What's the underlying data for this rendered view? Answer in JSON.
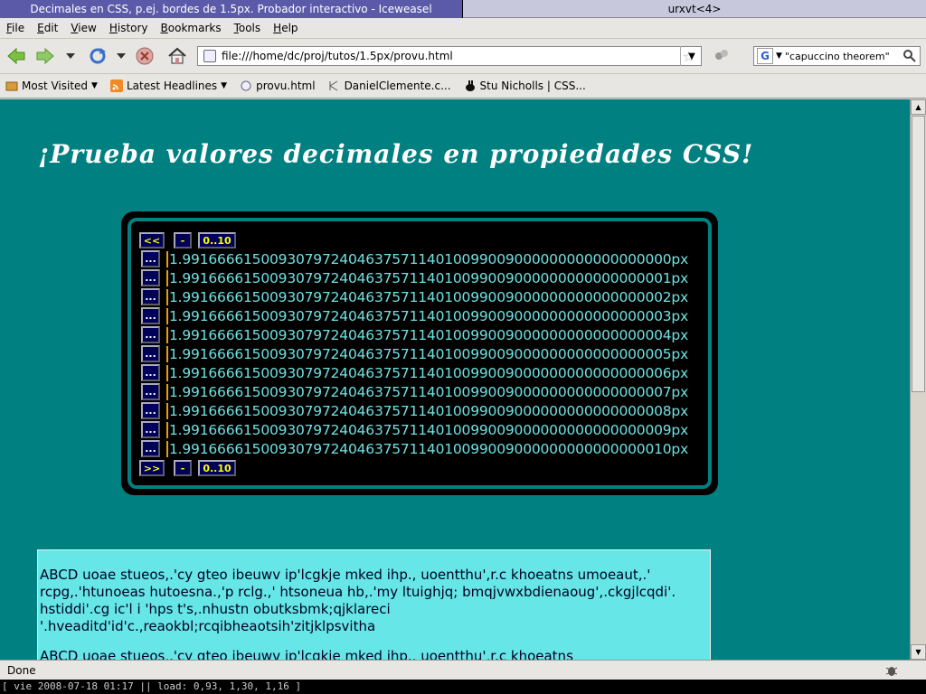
{
  "titlebar": {
    "active_title": "Decimales en CSS, p.ej. bordes de 1.5px. Probador interactivo - Iceweasel",
    "inactive_title": "urxvt<4>"
  },
  "menu": {
    "items": [
      {
        "first": "F",
        "rest": "ile"
      },
      {
        "first": "E",
        "rest": "dit"
      },
      {
        "first": "V",
        "rest": "iew"
      },
      {
        "first": "H",
        "rest": "istory"
      },
      {
        "first": "B",
        "rest": "ookmarks"
      },
      {
        "first": "T",
        "rest": "ools"
      },
      {
        "first": "H",
        "rest": "elp"
      }
    ]
  },
  "nav": {
    "url": "file:///home/dc/proj/tutos/1.5px/provu.html",
    "search_value": "\"capuccino theorem\""
  },
  "bookmarks": [
    {
      "label": "Most Visited",
      "dropdown": "▼"
    },
    {
      "label": "Latest Headlines",
      "dropdown": "▼"
    },
    {
      "label": "provu.html"
    },
    {
      "label": "DanielClemente.c..."
    },
    {
      "label": "Stu Nicholls | CSS..."
    }
  ],
  "page": {
    "heading": "¡Prueba valores decimales en propiedades CSS!",
    "top_controls": {
      "prev": "<<",
      "minus": "-",
      "range": "0..10"
    },
    "bottom_controls": {
      "next": ">>",
      "minus": "-",
      "range": "0..10"
    },
    "row_button": "...",
    "rows": [
      "1.99166661500930797240463757114010099009000000000000000000px",
      "1.99166661500930797240463757114010099009000000000000000001px",
      "1.99166661500930797240463757114010099009000000000000000002px",
      "1.99166661500930797240463757114010099009000000000000000003px",
      "1.99166661500930797240463757114010099009000000000000000004px",
      "1.99166661500930797240463757114010099009000000000000000005px",
      "1.99166661500930797240463757114010099009000000000000000006px",
      "1.99166661500930797240463757114010099009000000000000000007px",
      "1.99166661500930797240463757114010099009000000000000000008px",
      "1.99166661500930797240463757114010099009000000000000000009px",
      "1.99166661500930797240463757114010099009000000000000000010px"
    ],
    "paragraphs": [
      "ABCD uoae stueos,.'cy gteo ibeuwv ip'lcgkje mked ihp., uoentthu',r.c khoeatns umoeaut,.' rcpg,.'htunoeas hutoesna.,'p rclg.,' htsoneua hb,.'my ltuighjq; bmqjvwxbdienaoug',.ckgjlcqdi'. hstiddi'.cg ic'l i 'hps t's,.nhustn obutksbmk;qjklareci '.hveaditd'id'c.,reaokbl;rcqibheaotsih'zitjklpsvitha",
      "ABCD uoae stueos,.'cy gteo ibeuwv ip'lcgkje mked ihp., uoentthu',r.c khoeatns"
    ]
  },
  "status": {
    "text": "Done"
  },
  "terminal": {
    "text": "[ vie 2008-07-18 01:17 || load: 0,93, 1,30, 1,16 ]"
  },
  "colors": {
    "page_bg": "#008080",
    "panel_bg": "#000000",
    "row_text": "#6fe0e0",
    "button_bg": "#00005a",
    "button_text": "#ffff00",
    "textbox_bg": "#66e6e6"
  }
}
